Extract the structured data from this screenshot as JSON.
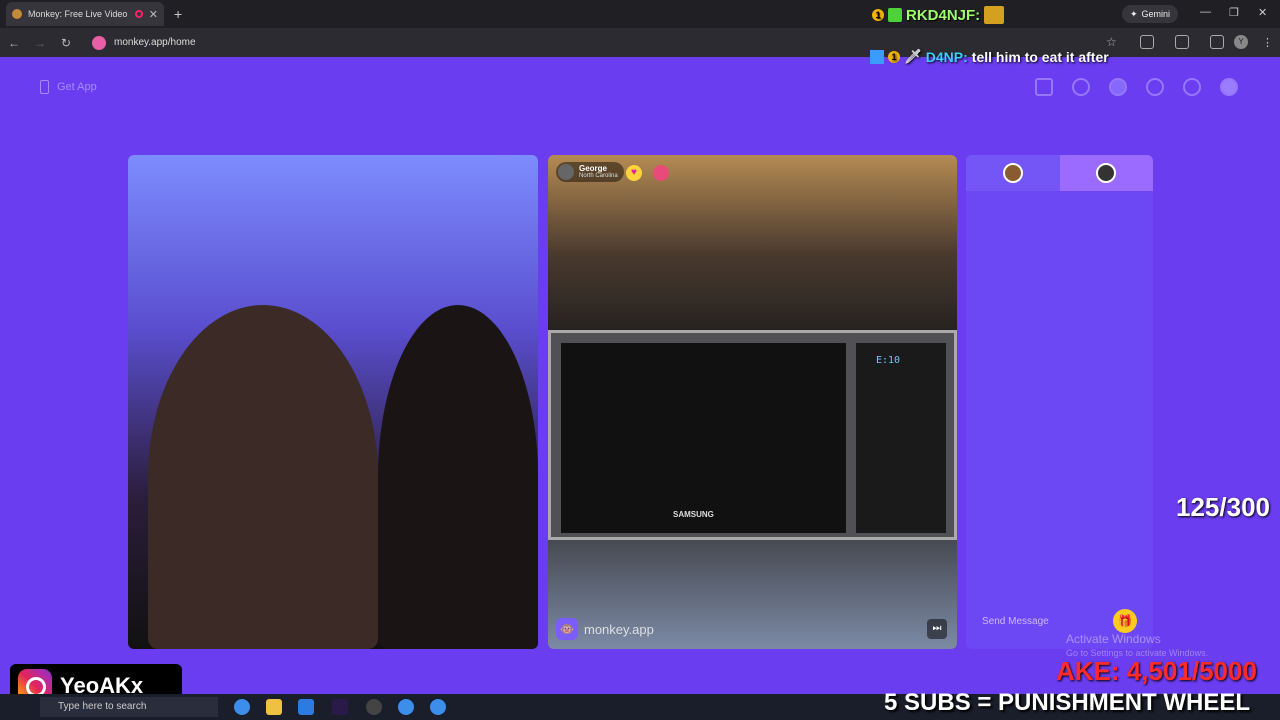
{
  "browser": {
    "tab_title": "Monkey: Free Live Video Ch",
    "new_tab": "+",
    "url": "monkey.app/home",
    "gemini_label": "Gemini",
    "profile_initial": "Y"
  },
  "overlays": {
    "top_line_num": "1",
    "top_line_user": "RKD4NJF:",
    "chat_num": "1",
    "chat_user": "D4NP:",
    "chat_message": "tell him to eat it after"
  },
  "header": {
    "get_app": "Get App"
  },
  "video": {
    "user_name": "George",
    "user_location": "North Carolina",
    "microwave_display": "E:10",
    "brand": "SAMSUNG",
    "watermark": "monkey.app"
  },
  "chat": {
    "send_placeholder": "Send Message"
  },
  "stream": {
    "sub_counter": "125/300",
    "activate_title": "Activate Windows",
    "activate_sub": "Go to Settings to activate Windows.",
    "goal": "AKE: 4,501/5000",
    "instagram_handle": "YeoAKx_",
    "punishment": "5 SUBS = PUNISHMENT WHEEL"
  },
  "taskbar": {
    "search_placeholder": "Type here to search"
  },
  "colors": {
    "app_bg": "#6a3df0",
    "chat_bg": "#6c48f4",
    "goal_red": "#ff2a2a"
  }
}
